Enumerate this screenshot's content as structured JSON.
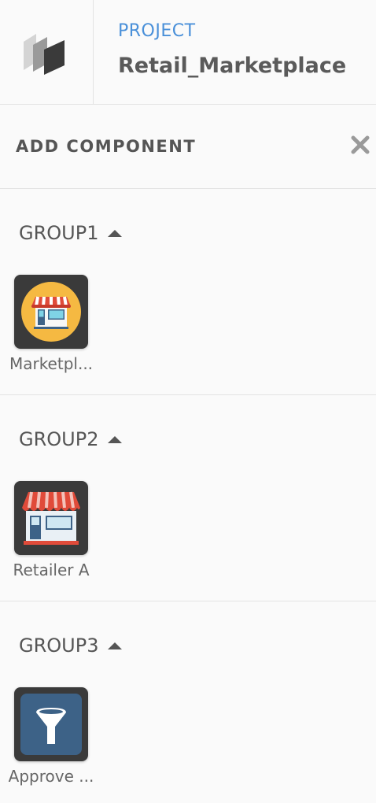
{
  "header": {
    "project_label": "PROJECT",
    "project_name": "Retail_Marketplace",
    "logo_icon": "layers-logo-icon"
  },
  "panel": {
    "title": "ADD COMPONENT",
    "close_icon": "close-icon"
  },
  "groups": [
    {
      "name": "GROUP1",
      "caret_icon": "caret-up-icon",
      "components": [
        {
          "label": "Marketpl...",
          "icon": "storefront-icon"
        }
      ]
    },
    {
      "name": "GROUP2",
      "caret_icon": "caret-up-icon",
      "components": [
        {
          "label": "Retailer A",
          "icon": "shop-icon"
        }
      ]
    },
    {
      "name": "GROUP3",
      "caret_icon": "caret-up-icon",
      "components": [
        {
          "label": "Approve ...",
          "icon": "funnel-icon"
        }
      ]
    }
  ],
  "colors": {
    "accent": "#4a90d9",
    "tile_bg": "#3a3a3a",
    "marketplace_circle": "#f5b942",
    "awning_red": "#e04b3a",
    "filter_bg": "#3d6287"
  }
}
